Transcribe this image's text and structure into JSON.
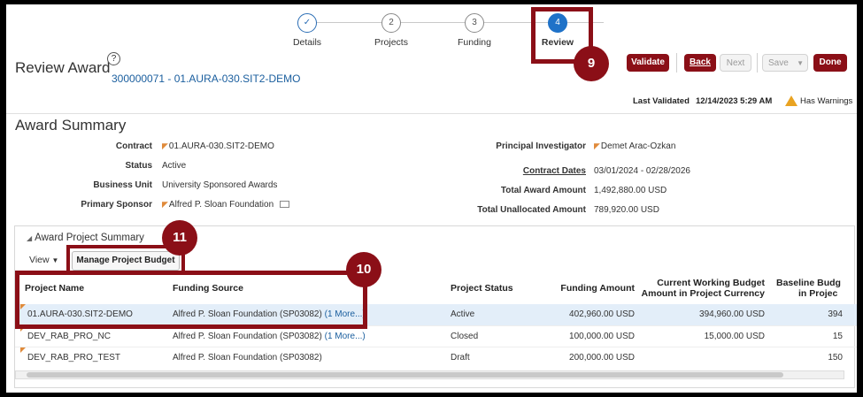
{
  "train": {
    "steps": [
      {
        "label": "Details",
        "marker": "✓"
      },
      {
        "label": "Projects",
        "marker": "2"
      },
      {
        "label": "Funding",
        "marker": "3"
      },
      {
        "label": "Review",
        "marker": "4"
      }
    ]
  },
  "header": {
    "title": "Review Award",
    "help": "?",
    "award_id": "300000071 - 01.AURA-030.SIT2-DEMO"
  },
  "toolbar": {
    "validate": "Validate",
    "back": "Back",
    "next": "Next",
    "save": "Save",
    "save_menu": "▼",
    "done": "Done"
  },
  "status": {
    "last_validated_label": "Last Validated",
    "last_validated_value": "12/14/2023 5:29 AM",
    "warning_text": "Has Warnings"
  },
  "summary": {
    "title": "Award Summary",
    "left": [
      {
        "label": "Contract",
        "value": "01.AURA-030.SIT2-DEMO"
      },
      {
        "label": "Status",
        "value": "Active"
      },
      {
        "label": "Business Unit",
        "value": "University Sponsored Awards"
      },
      {
        "label": "Primary Sponsor",
        "value": "Alfred P. Sloan Foundation"
      }
    ],
    "right": [
      {
        "label": "Principal Investigator",
        "value": "Demet Arac-Ozkan"
      },
      {
        "label": "Contract Dates",
        "value": "03/01/2024 - 02/28/2026"
      },
      {
        "label": "Total Award Amount",
        "value": "1,492,880.00  USD"
      },
      {
        "label": "Total Unallocated Amount",
        "value": "789,920.00  USD"
      }
    ]
  },
  "project_summary": {
    "title": "Award Project Summary",
    "view_label": "View",
    "manage_button": "Manage Project Budget",
    "columns": [
      "Project Name",
      "Funding Source",
      "Project Status",
      "Funding Amount",
      "Current Working Budget",
      "Amount in Project Currency",
      "Baseline Budg",
      "in Projec"
    ],
    "rows": [
      {
        "name": "01.AURA-030.SIT2-DEMO",
        "source": "Alfred P. Sloan Foundation (SP03082)",
        "more": "(1 More...)",
        "status": "Active",
        "funding": "402,960.00  USD",
        "current": "394,960.00  USD",
        "baseline": "394"
      },
      {
        "name": "DEV_RAB_PRO_NC",
        "source": "Alfred P. Sloan Foundation (SP03082)",
        "more": "(1 More...)",
        "status": "Closed",
        "funding": "100,000.00  USD",
        "current": "15,000.00  USD",
        "baseline": "15"
      },
      {
        "name": "DEV_RAB_PRO_TEST",
        "source": "Alfred P. Sloan Foundation (SP03082)",
        "more": "",
        "status": "Draft",
        "funding": "200,000.00  USD",
        "current": "",
        "baseline": "150"
      }
    ]
  },
  "callouts": [
    "9",
    "10",
    "11"
  ],
  "colors": {
    "accent": "#8b0f17",
    "link": "#1a5e9e",
    "train_current": "#1f72c8",
    "warning": "#e9a321"
  }
}
